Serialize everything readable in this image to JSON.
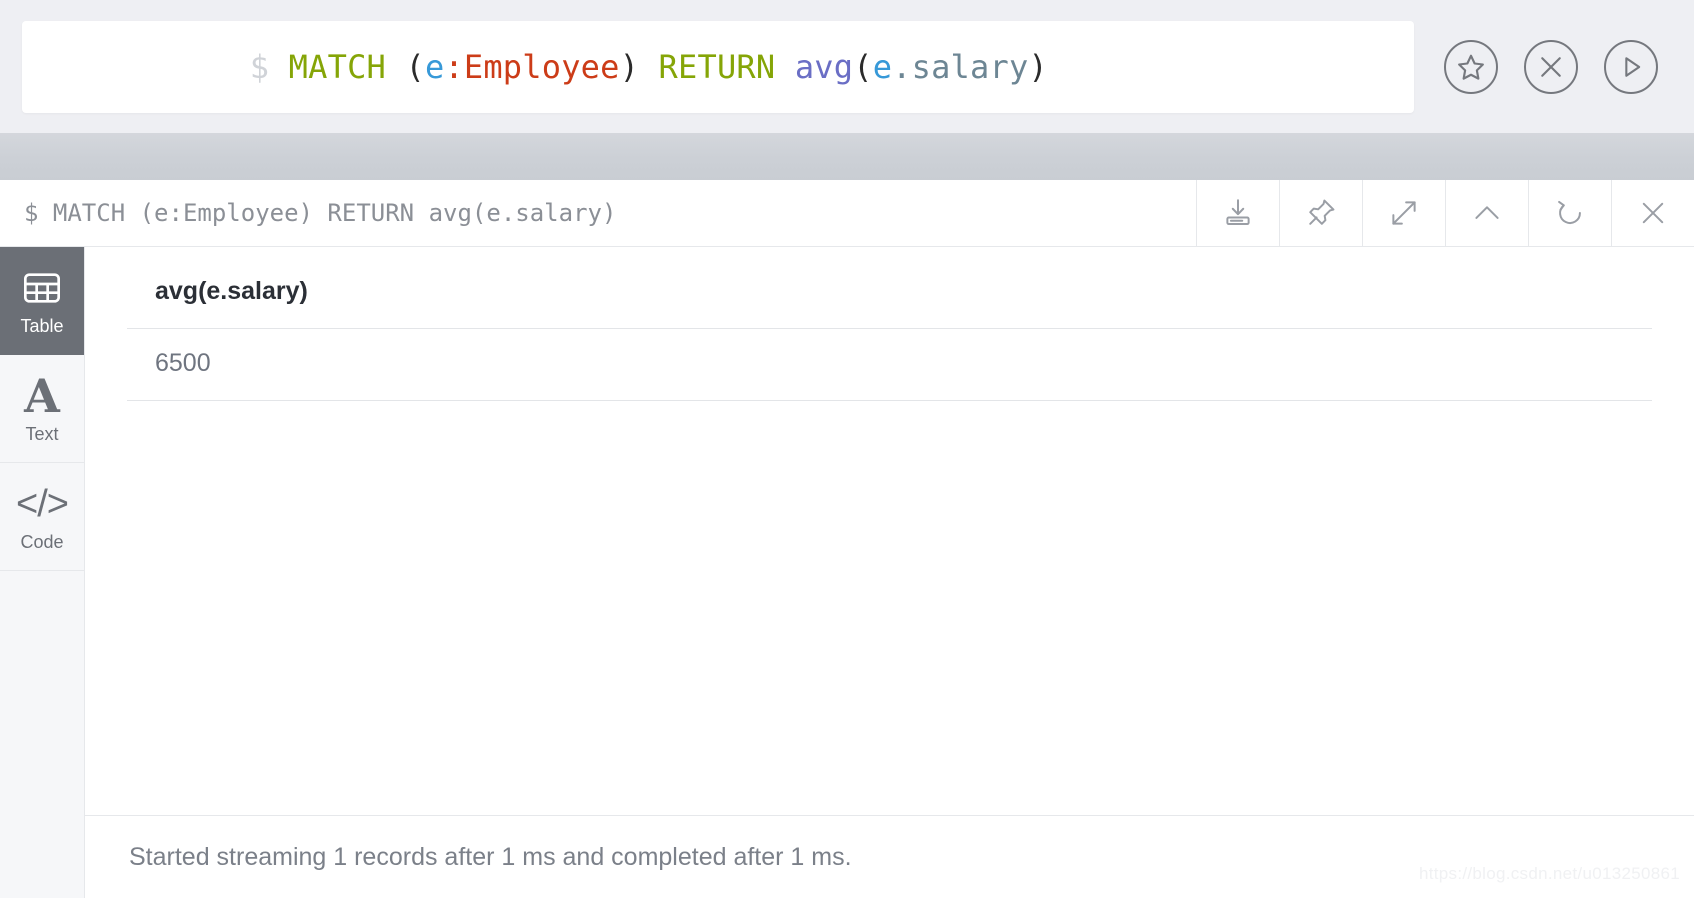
{
  "editor": {
    "prompt": "$",
    "query_tokens": [
      {
        "text": "$",
        "type": "prompt"
      },
      {
        "text": " ",
        "type": "plain"
      },
      {
        "text": "MATCH",
        "type": "keyword"
      },
      {
        "text": " ",
        "type": "plain"
      },
      {
        "text": "(",
        "type": "paren"
      },
      {
        "text": "e",
        "type": "variable"
      },
      {
        "text": ":Employee",
        "type": "label"
      },
      {
        "text": ")",
        "type": "paren"
      },
      {
        "text": " ",
        "type": "plain"
      },
      {
        "text": "RETURN",
        "type": "keyword"
      },
      {
        "text": " ",
        "type": "plain"
      },
      {
        "text": "avg",
        "type": "function"
      },
      {
        "text": "(",
        "type": "paren"
      },
      {
        "text": "e",
        "type": "variable"
      },
      {
        "text": ".salary",
        "type": "property"
      },
      {
        "text": ")",
        "type": "paren"
      }
    ],
    "query_text": "$ MATCH (e:Employee) RETURN avg(e.salary)",
    "actions": [
      {
        "name": "favorite-button",
        "icon": "star-icon",
        "label": "Favorite"
      },
      {
        "name": "clear-button",
        "icon": "close-icon",
        "label": "Clear"
      },
      {
        "name": "run-button",
        "icon": "play-icon",
        "label": "Run"
      }
    ],
    "colors": {
      "prompt": "#d0d3d8",
      "keyword": "#85a507",
      "variable": "#3799d8",
      "label": "#cc3c18",
      "paren": "#2b2b2b",
      "function": "#6a6ec5",
      "property": "#6d8694",
      "background": "#eeeff3"
    }
  },
  "frame": {
    "title": "$ MATCH (e:Employee) RETURN avg(e.salary)",
    "tools": [
      {
        "name": "download-button",
        "icon": "download-icon",
        "label": "Download"
      },
      {
        "name": "pin-button",
        "icon": "pin-icon",
        "label": "Pin"
      },
      {
        "name": "expand-button",
        "icon": "expand-icon",
        "label": "Fullscreen"
      },
      {
        "name": "collapse-button",
        "icon": "chevron-up-icon",
        "label": "Collapse"
      },
      {
        "name": "refresh-button",
        "icon": "refresh-icon",
        "label": "Rerun"
      },
      {
        "name": "close-button",
        "icon": "close-icon",
        "label": "Close"
      }
    ]
  },
  "view_tabs": [
    {
      "name": "tab-table",
      "label": "Table",
      "icon": "table-icon",
      "active": true
    },
    {
      "name": "tab-text",
      "label": "Text",
      "icon": "text-icon",
      "active": false
    },
    {
      "name": "tab-code",
      "label": "Code",
      "icon": "code-icon",
      "active": false
    }
  ],
  "result_table": {
    "columns": [
      "avg(e.salary)"
    ],
    "rows": [
      [
        "6500"
      ]
    ]
  },
  "status": {
    "message": "Started streaming 1 records after 1 ms and completed after 1 ms."
  },
  "watermark": {
    "text": "https://blog.csdn.net/u013250861"
  }
}
